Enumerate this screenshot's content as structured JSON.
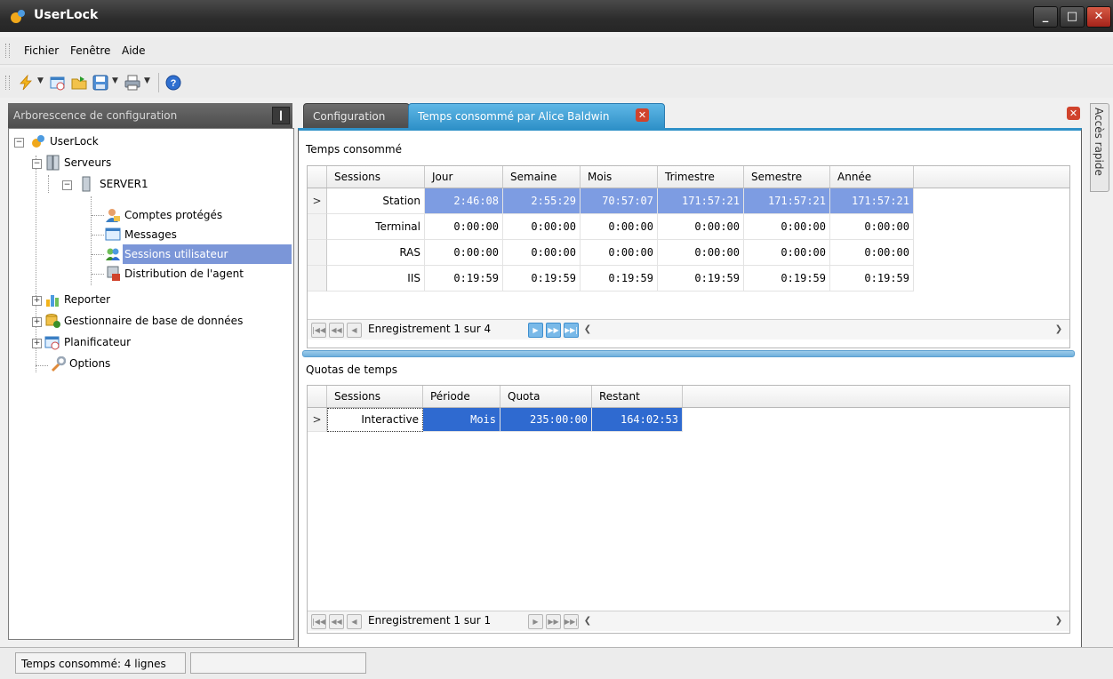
{
  "window": {
    "title": "UserLock"
  },
  "menu": {
    "items": [
      "Fichier",
      "Fenêtre",
      "Aide"
    ]
  },
  "toolbar": {
    "icons": [
      "lightning-icon",
      "schedule-icon",
      "open-folder-icon",
      "save-icon",
      "print-icon",
      "help-icon"
    ]
  },
  "left_panel": {
    "title": "Arborescence de configuration",
    "pin": "❙",
    "tree": [
      {
        "label": "UserLock"
      },
      {
        "label": "Serveurs"
      },
      {
        "label": "SERVER1"
      },
      {
        "label": "Comptes protégés"
      },
      {
        "label": "Messages"
      },
      {
        "label": "Sessions utilisateur"
      },
      {
        "label": "Distribution de l'agent"
      },
      {
        "label": "Reporter"
      },
      {
        "label": "Gestionnaire de base de données"
      },
      {
        "label": "Planificateur"
      },
      {
        "label": "Options"
      }
    ]
  },
  "tabs": [
    {
      "label": "Configuration"
    },
    {
      "label": "Temps consommé par Alice Baldwin"
    }
  ],
  "side_tab": {
    "label": "Accès rapide"
  },
  "time_grid": {
    "title": "Temps consommé",
    "columns": [
      "Sessions",
      "Jour",
      "Semaine",
      "Mois",
      "Trimestre",
      "Semestre",
      "Année"
    ],
    "rows": [
      [
        "Station",
        "2:46:08",
        "2:55:29",
        "70:57:07",
        "171:57:21",
        "171:57:21",
        "171:57:21"
      ],
      [
        "Terminal",
        "0:00:00",
        "0:00:00",
        "0:00:00",
        "0:00:00",
        "0:00:00",
        "0:00:00"
      ],
      [
        "RAS",
        "0:00:00",
        "0:00:00",
        "0:00:00",
        "0:00:00",
        "0:00:00",
        "0:00:00"
      ],
      [
        "IIS",
        "0:19:59",
        "0:19:59",
        "0:19:59",
        "0:19:59",
        "0:19:59",
        "0:19:59"
      ]
    ],
    "nav_text": "Enregistrement 1 sur 4"
  },
  "quota_grid": {
    "title": "Quotas de temps",
    "columns": [
      "Sessions",
      "Période",
      "Quota",
      "Restant"
    ],
    "rows": [
      [
        "Interactive",
        "Mois",
        "235:00:00",
        "164:02:53"
      ]
    ],
    "nav_text": "Enregistrement 1 sur 1"
  },
  "status": {
    "text": "Temps consommé: 4 lignes"
  },
  "colors": {
    "accent": "#2f91c8",
    "selection": "#7d9ce2",
    "selection_strong": "#2f6ad0",
    "close": "#d0432c"
  }
}
